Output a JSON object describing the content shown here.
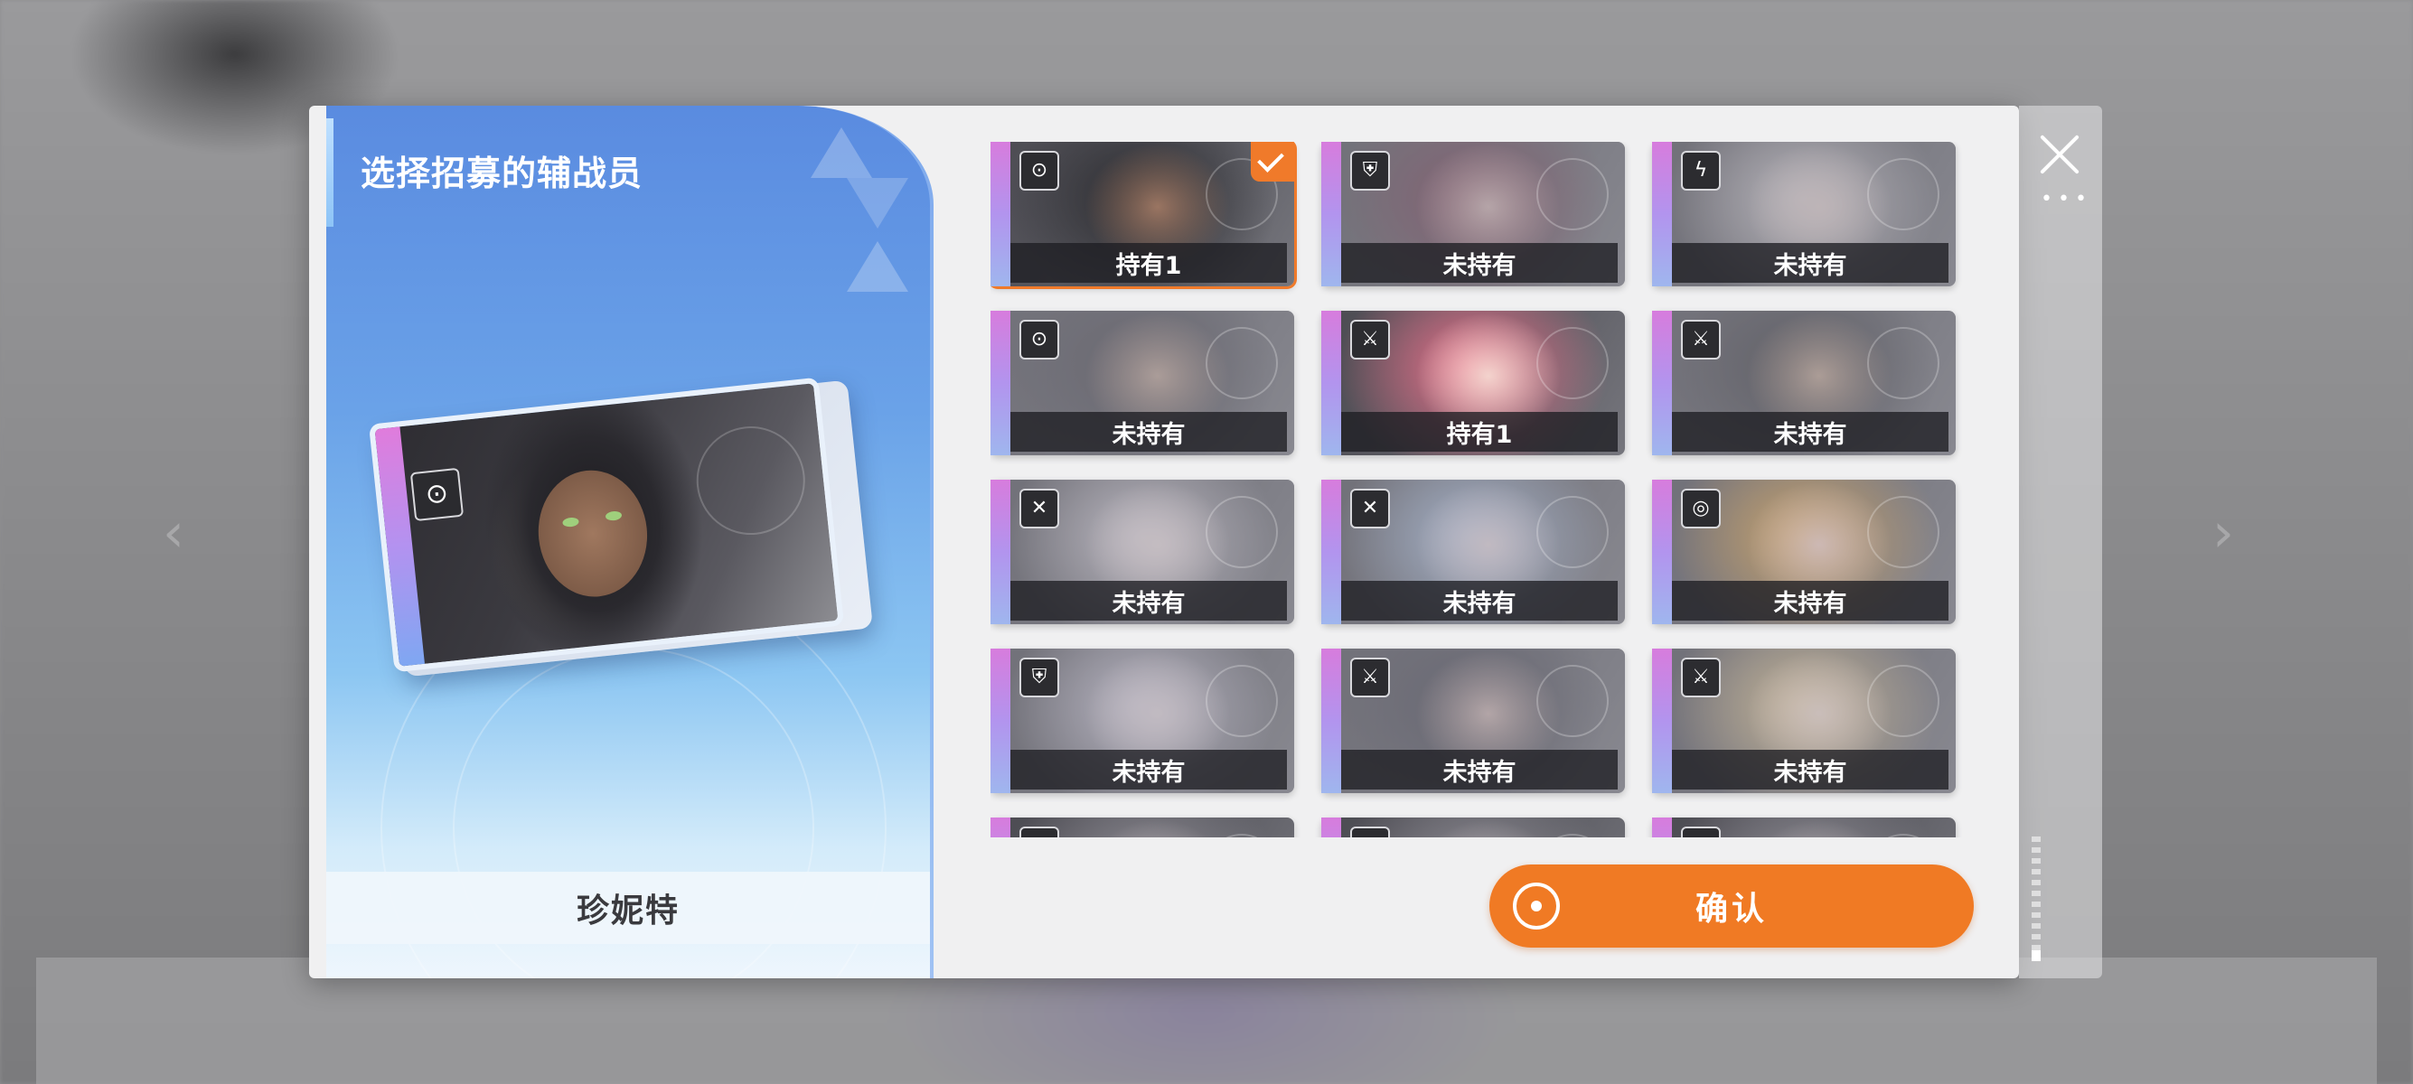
{
  "left_panel": {
    "title": "选择招募的辅战员",
    "selected_name": "珍妮特",
    "preview_class_icon": "target-class-icon"
  },
  "grid": {
    "cards": [
      {
        "class_icon": "target-class-icon",
        "glyph": "⊙",
        "label": "持有1",
        "selected": true,
        "hair": "#2a2a2e",
        "face": "#9a7562"
      },
      {
        "class_icon": "shield-class-icon",
        "glyph": "⛨",
        "label": "未持有",
        "selected": false,
        "hair": "#6a2c44",
        "face": "#c7a9a8"
      },
      {
        "class_icon": "lightning-class-icon",
        "glyph": "ϟ",
        "label": "未持有",
        "selected": false,
        "hair": "#c9c4c8",
        "face": "#d6c6c4"
      },
      {
        "class_icon": "target-class-icon",
        "glyph": "⊙",
        "label": "未持有",
        "selected": false,
        "hair": "#3c3942",
        "face": "#b49a8c"
      },
      {
        "class_icon": "crossed-swords-class-icon",
        "glyph": "⚔",
        "label": "持有1",
        "selected": false,
        "hair": "#ea6f8a",
        "face": "#f3d3cd"
      },
      {
        "class_icon": "crossed-swords-class-icon",
        "glyph": "⚔",
        "label": "未持有",
        "selected": false,
        "hair": "#2d2c31",
        "face": "#b59a88"
      },
      {
        "class_icon": "blades-class-icon",
        "glyph": "✕",
        "label": "未持有",
        "selected": false,
        "hair": "#cfc9d2",
        "face": "#e2d4d6"
      },
      {
        "class_icon": "blades-class-icon",
        "glyph": "✕",
        "label": "未持有",
        "selected": false,
        "hair": "#a9bfe0",
        "face": "#dccfd6"
      },
      {
        "class_icon": "crosshair-class-icon",
        "glyph": "◎",
        "label": "未持有",
        "selected": false,
        "hair": "#e9a43a",
        "face": "#f1cdbe"
      },
      {
        "class_icon": "shield-class-icon",
        "glyph": "⛨",
        "label": "未持有",
        "selected": false,
        "hair": "#c9c4d4",
        "face": "#dcd0d6"
      },
      {
        "class_icon": "crossed-swords-class-icon",
        "glyph": "⚔",
        "label": "未持有",
        "selected": false,
        "hair": "#3a3946",
        "face": "#c2aaa6"
      },
      {
        "class_icon": "crossed-swords-class-icon",
        "glyph": "⚔",
        "label": "未持有",
        "selected": false,
        "hair": "#e1c48a",
        "face": "#ecd6c8"
      },
      {
        "class_icon": "target-class-icon",
        "glyph": "⊙",
        "label": "",
        "selected": false,
        "hair": "#8c8a92",
        "face": "#b0a9ad"
      },
      {
        "class_icon": "shield-class-icon",
        "glyph": "⛨",
        "label": "",
        "selected": false,
        "hair": "#8c8a92",
        "face": "#b0a9ad"
      },
      {
        "class_icon": "shield-class-icon",
        "glyph": "⛨",
        "label": "",
        "selected": false,
        "hair": "#8c8a92",
        "face": "#b0a9ad"
      }
    ]
  },
  "confirm_button": {
    "label": "确认"
  },
  "colors": {
    "accent": "#f07a24",
    "panel_blue": "#5a8be0"
  }
}
